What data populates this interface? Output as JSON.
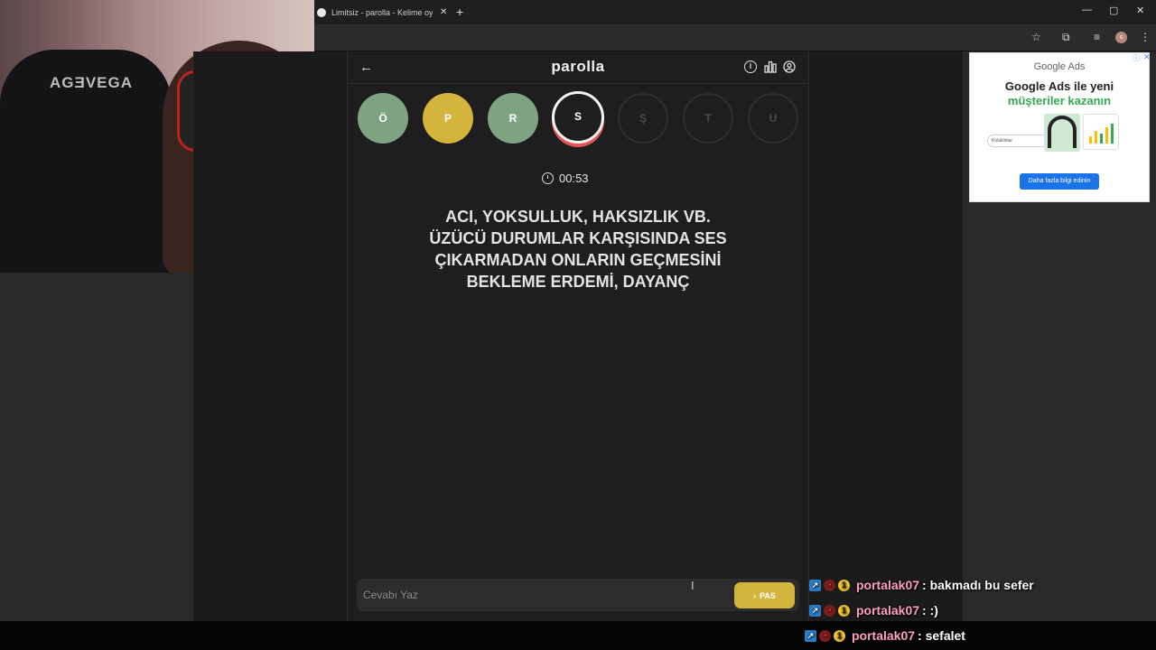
{
  "browser": {
    "tab_title": "Limitsiz - parolla - Kelime oyunu",
    "tab_close": "✕",
    "new_tab": "+",
    "window_controls": [
      "—",
      "▢",
      "✕"
    ],
    "profile_initial": "s"
  },
  "webcam": {
    "chair_logo": "AGƎVEGA"
  },
  "game": {
    "title": "parolla",
    "back": "←",
    "letters": [
      {
        "letter": "Ö",
        "state": "correct",
        "color": "#7fa282"
      },
      {
        "letter": "P",
        "state": "passed",
        "color": "#d5b43c"
      },
      {
        "letter": "R",
        "state": "correct",
        "color": "#7fa282"
      },
      {
        "letter": "S",
        "state": "current",
        "color": "#1e1e1e"
      },
      {
        "letter": "Ş",
        "state": "empty"
      },
      {
        "letter": "T",
        "state": "empty"
      },
      {
        "letter": "U",
        "state": "empty"
      }
    ],
    "timer": "00:53",
    "clue_lines": [
      "ACI, YOKSULLUK, HAKSIZLIK VB.",
      "ÜZÜCÜ DURUMLAR KARŞISINDA SES",
      "ÇIKARMADAN ONLARIN GEÇMESİNİ",
      "BEKLEME ERDEMİ, DAYANÇ"
    ],
    "answer_placeholder": "Cevabı Yaz",
    "pass_label": "PAS",
    "info_icon_glyph": "i",
    "accent_color": "#d5b43c"
  },
  "ad": {
    "brand": "Google Ads",
    "headline_1": "Google Ads ile yeni",
    "headline_2": "müşteriler kazanın",
    "search_text": "Kulaklıklar",
    "cta": "Daha fazla bilgi edinin",
    "info": "ⓘ",
    "close": "✕"
  },
  "chat": [
    {
      "user": "portalak07",
      "message": ": bakmadı bu sefer"
    },
    {
      "user": "portalak07",
      "message": ": :)"
    },
    {
      "user": "portalak07",
      "message": ": sefalet"
    }
  ]
}
